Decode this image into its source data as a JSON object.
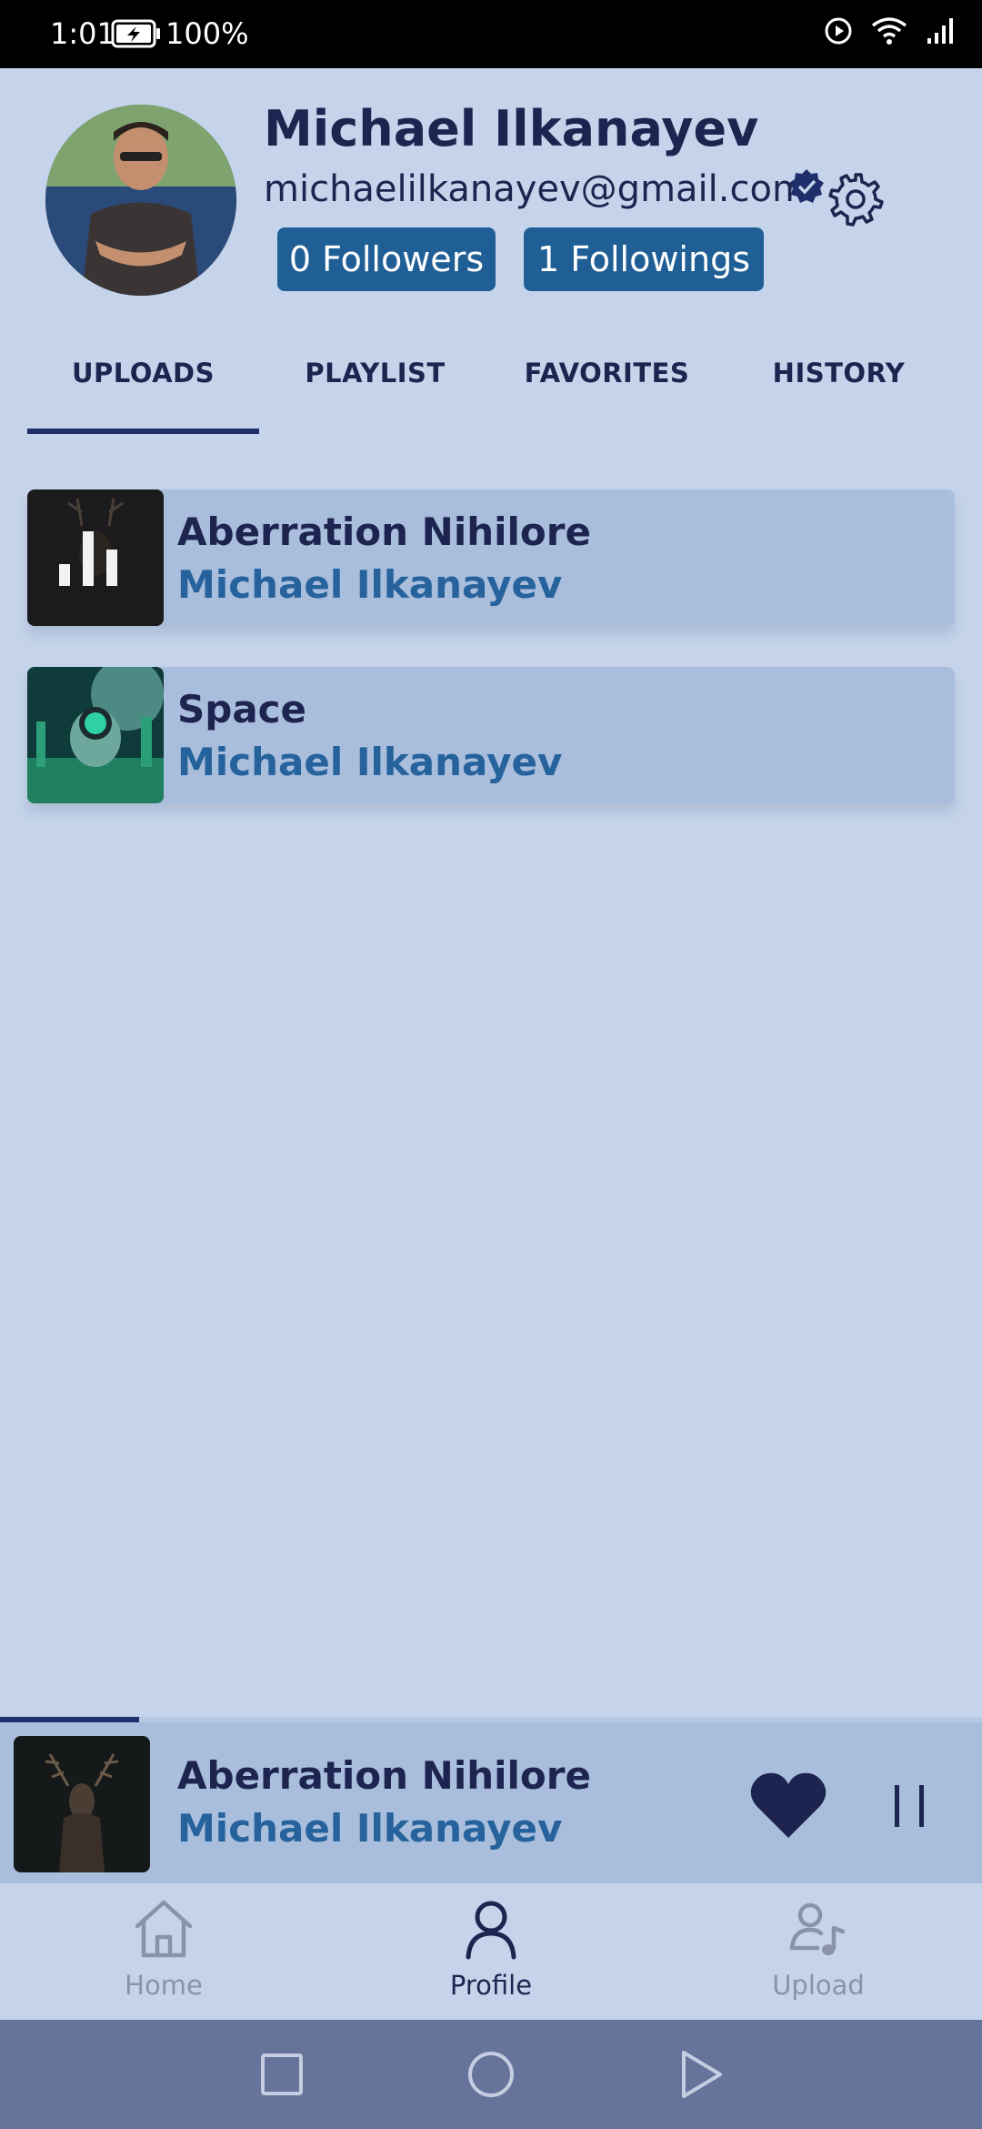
{
  "status_bar": {
    "time": "1:01",
    "battery": "100%"
  },
  "profile": {
    "name": "Michael Ilkanayev",
    "email": "michaelilkanayev@gmail.com",
    "followers": "0 Followers",
    "followings": "1 Followings"
  },
  "tabs": [
    {
      "label": "UPLOADS",
      "selected": true
    },
    {
      "label": "PLAYLIST",
      "selected": false
    },
    {
      "label": "FAVORITES",
      "selected": false
    },
    {
      "label": "HISTORY",
      "selected": false
    }
  ],
  "uploads": [
    {
      "title": "Aberration Nihilore",
      "artist": "Michael Ilkanayev",
      "playing": true
    },
    {
      "title": "Space",
      "artist": "Michael Ilkanayev",
      "playing": false
    }
  ],
  "now_playing": {
    "title": "Aberration Nihilore",
    "artist": "Michael Ilkanayev",
    "progress": 0.142,
    "liked": true
  },
  "bottom_nav": [
    {
      "label": "Home",
      "icon": "home-icon",
      "active": false
    },
    {
      "label": "Profile",
      "icon": "profile-icon",
      "active": true
    },
    {
      "label": "Upload",
      "icon": "upload-icon",
      "active": false
    }
  ],
  "colors": {
    "background": "#c5d4eb",
    "card": "#a9bedc",
    "accent_dark": "#1e2f6b",
    "accent_blue": "#1f5f96",
    "artist_text": "#26629c",
    "system_nav": "#66739b"
  }
}
